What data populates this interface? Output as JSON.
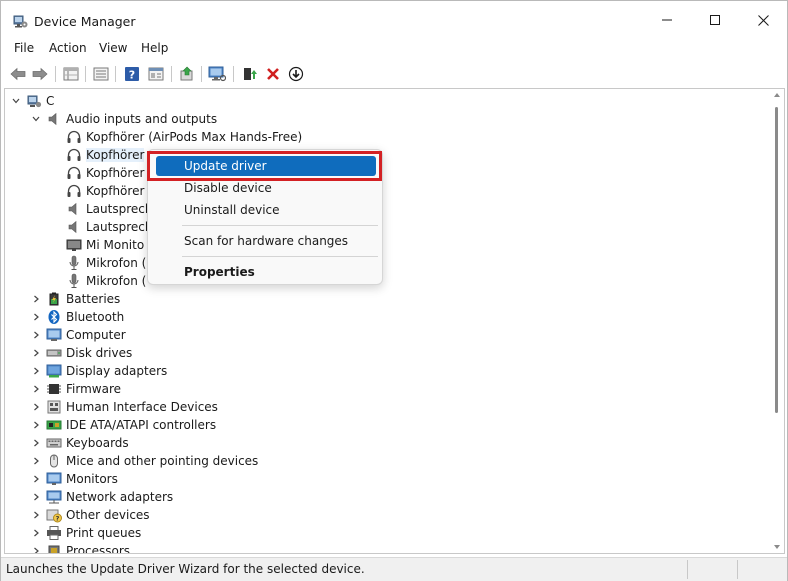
{
  "window": {
    "title": "Device Manager"
  },
  "menu": {
    "items": [
      "File",
      "Action",
      "View",
      "Help"
    ]
  },
  "toolbar": {
    "icons": [
      "back-arrow-icon",
      "forward-arrow-icon",
      "properties-grid-icon",
      "list-view-icon",
      "help-icon",
      "details-pane-icon",
      "update-driver-icon",
      "monitor-scan-icon",
      "enable-device-icon",
      "uninstall-x-icon",
      "download-driver-icon"
    ]
  },
  "tree": {
    "root": "C",
    "audio": {
      "label": "Audio inputs and outputs",
      "children": [
        "Kopfhörer (AirPods Max Hands-Free)",
        "Kopfhörer",
        "Kopfhörer",
        "Kopfhörer",
        "Lautsprech",
        "Lautsprech",
        "Mi Monito",
        "Mikrofon (",
        "Mikrofon ("
      ]
    },
    "categories": [
      "Batteries",
      "Bluetooth",
      "Computer",
      "Disk drives",
      "Display adapters",
      "Firmware",
      "Human Interface Devices",
      "IDE ATA/ATAPI controllers",
      "Keyboards",
      "Mice and other pointing devices",
      "Monitors",
      "Network adapters",
      "Other devices",
      "Print queues",
      "Processors"
    ]
  },
  "context_menu": {
    "update_driver": "Update driver",
    "disable_device": "Disable device",
    "uninstall_device": "Uninstall device",
    "scan_hardware": "Scan for hardware changes",
    "properties": "Properties"
  },
  "status": {
    "text": "Launches the Update Driver Wizard for the selected device."
  },
  "colors": {
    "highlight": "#0f6cbd",
    "annotation_box": "#d32124"
  }
}
